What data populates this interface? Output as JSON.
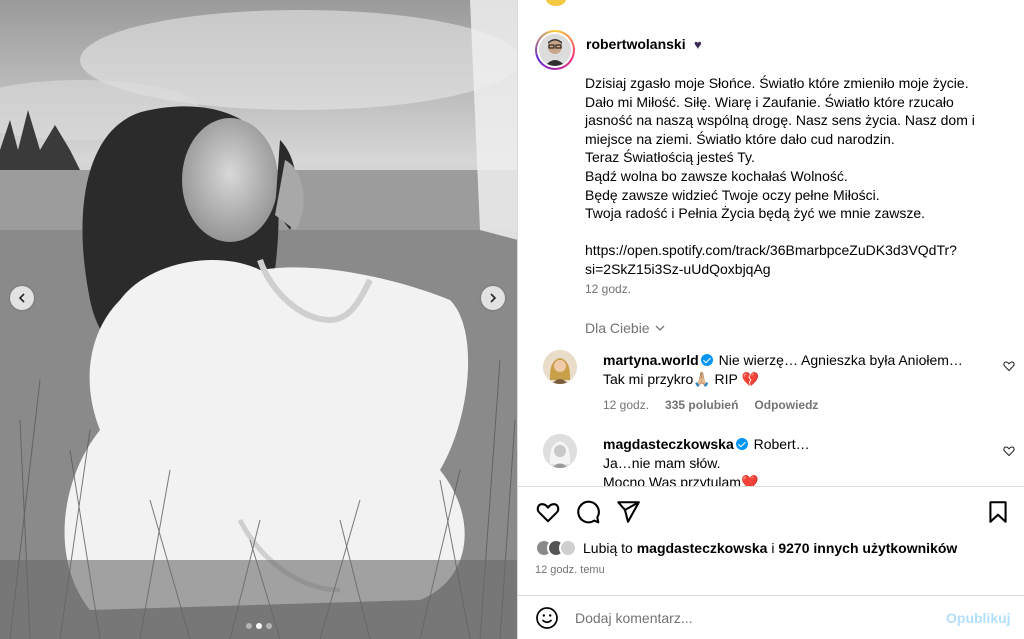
{
  "post": {
    "username": "robertwolanski",
    "username_emoji": "♥",
    "caption": "Dzisiaj zgasło moje Słońce. Światło które zmieniło moje życie. Dało mi Miłość. Siłę. Wiarę i Zaufanie. Światło które rzucało jasność na naszą wspólną drogę. Nasz sens życia. Nasz dom i miejsce na ziemi. Światło które dało cud narodzin.\nTeraz Światłością jesteś Ty.\nBądź wolna bo zawsze kochałaś Wolność.\nBędę zawsze widzieć Twoje oczy pełne Miłości.\nTwoja radość i Pełnia Życia będą żyć we mnie zawsze.\n\nhttps://open.spotify.com/track/36BmarbpceZuDK3d3VQdTr?si=2SkZ15i3Sz-uUdQoxbjqAg",
    "caption_time": "12 godz.",
    "for_you_label": "Dla Ciebie"
  },
  "comments": [
    {
      "username": "martyna.world",
      "text": " Nie wierzę… Agnieszka była Aniołem… Tak mi przykro🙏🏼 RIP 💔",
      "time": "12 godz.",
      "likes": "335 polubień",
      "reply": "Odpowiedz"
    },
    {
      "username": "magdasteczkowska",
      "text_line1": " Robert…",
      "text_line2": "Ja…nie mam słów.",
      "text_line3": "Mocno Was przytulam❤️"
    }
  ],
  "likes": {
    "prefix": "Lubią to",
    "user": "magdasteczkowska",
    "conjunction": "i",
    "others": "9270 innych użytkowników"
  },
  "post_time": "12 godz. temu",
  "comment_input": {
    "placeholder": "Dodaj komentarz...",
    "publish_label": "Opublikuj"
  },
  "carousel": {
    "slide_count": 3,
    "active_slide": 2
  },
  "colors": {
    "link_blue": "#0095f6",
    "publish_disabled": "#b2dffc",
    "muted": "#737373"
  }
}
